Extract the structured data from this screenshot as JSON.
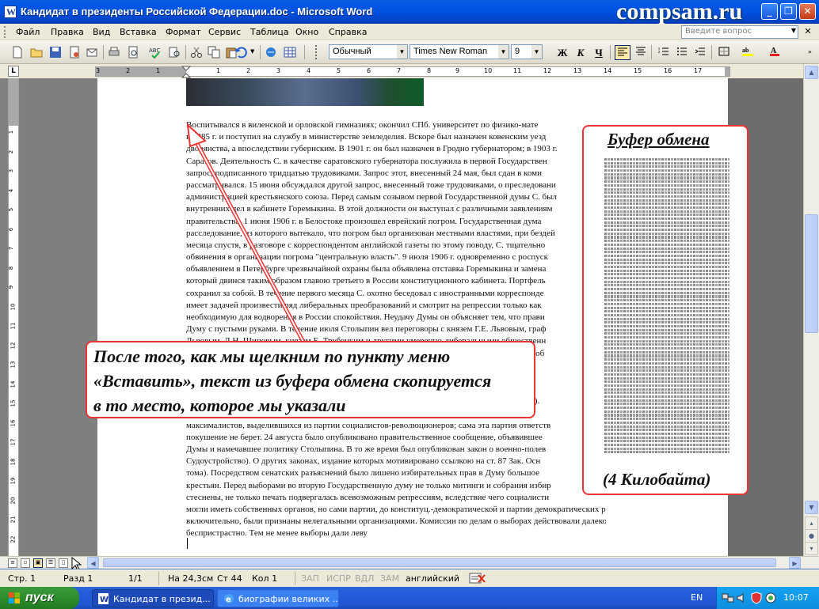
{
  "window": {
    "title": "Кандидат в президенты Российской Федерации.doc - Microsoft Word",
    "watermark": "compsam.ru"
  },
  "menubar": {
    "items": [
      "Файл",
      "Правка",
      "Вид",
      "Вставка",
      "Формат",
      "Сервис",
      "Таблица",
      "Окно",
      "Справка"
    ],
    "ask_placeholder": "Введите вопрос"
  },
  "toolbar": {
    "style": "Обычный",
    "font": "Times New Roman",
    "size": "9",
    "bold": "Ж",
    "italic": "К",
    "underline": "Ч"
  },
  "ruler": {
    "labels": [
      "3",
      "2",
      "1",
      "1",
      "2",
      "3",
      "4",
      "5",
      "6",
      "7",
      "8",
      "9",
      "10",
      "11",
      "12",
      "13",
      "14",
      "15",
      "16",
      "17"
    ],
    "tab_selector": "L"
  },
  "vruler": {
    "labels": [
      "1",
      "2",
      "3",
      "4",
      "5",
      "6",
      "7",
      "8",
      "9",
      "10",
      "11",
      "12",
      "13",
      "14",
      "15",
      "16",
      "17",
      "18",
      "19",
      "20",
      "21",
      "22"
    ]
  },
  "document": {
    "lines": [
      "Воспитывался в виленской и орловской гимназиях; окончил СПб. университет по физико-мате",
      "в 1885 г. и поступил на службу в министерстве земледелия. Вскоре был назначен ковенским уезд",
      "дворянства, а впоследствии губернским. В 1901 г. он был назначен в Гродно губернатором; в 1903 г.",
      "Саратов. Деятельность С. в качестве саратовского губернатора послужила в первой Государствен",
      "запрос, подписанного тридцатью трудовиками. Запрос этот, внесенный 24 мая, был сдан в коми",
      "рассматривался. 15 июня обсуждался другой запрос, внесенный тоже трудовиками, о преследовани",
      "администрацией крестьянского союза. Перед самым созывом первой Государственной думы С. был",
      "внутренних дел в кабинете Горемыкина. В этой должности он выступал с различными заявлениям",
      "правительства. 1 июня 1906 г. в Белостоке произошел еврейский погром. Государственная дума",
      "расследование, из которого вытекало, что погром был организован местными властями, при бездей",
      "месяца спустя, в разговоре с корреспондентом английской газеты по этому поводу, С. тщательно",
      "обвинения в организации погрома \"центральную власть\". 9 июля 1906 г. одновременно с роспуск",
      "объявлением в Петербурге чрезвычайной охраны была объявлена отставка Горемыкина и заменa",
      "который двинся таким образом главою третьего в России конституционного кабинета. Портфель",
      "сохранил за собой. В течение первого месяца С. охотно беседовал с иностранными корреспонде",
      "имеет задачей произвести ряд либеральных преобразований и смотрит на репрессии только как",
      "необходимую для водворения в России спокойствия. Неудачу Думы он объясняет тем, что прави",
      "Думу с пустыми руками. В течение июля Столыпин вел переговоры с князем Г.Е. Львовым, граф",
      "Львовым, Д.Н. Шиповым, князем Е. Трубецким и другими умеренно-либеральными общественн",
      "стараясь привлечь их в свой кабинет; но переговоры не привели ни к чему. С. обвинил в этом об",
      "",
      "",
      "",
      "получение, посредством лакея телеграммы на его даче (на Аптекарском острове в Петербурге).",
      "",
      "максималистов, выделившихся из партии социалистов-революционеров; сама эта партия ответств",
      "покушение не берет. 24 августа было опубликовано правительственное сообщение, объявившее",
      "Думы и намечавшее политику Столыпина. В то же время был опубликован закон о военно-полев",
      "Судоустройство). О других законах, издание которых мотивировано ссылкою на ст. 87 Зак. Осн",
      "тома). Посредством сенатских разъяснений было лишено избирательных прав в Думу большое",
      "крестьян. Перед выборами во вторую Государственную думу не только митинги и собрания избир",
      "стеснены, не только печать подвергалась всевозможным репрессиям, вследствие чего социалисти",
      "могли иметь собственных органов, но сами партии, до конституц.-демократической и партии демократических реформ",
      "включительно, были признаны нелегальными организациями. Комиссии по делам о выборах действовали далеко не",
      "беспристрастно. Тем не менее выборы дали леву"
    ]
  },
  "annotations": {
    "clipboard_title": "Буфер обмена",
    "clipboard_size": "(4 Килобайта)",
    "callout_lines": [
      "После того, как мы щелкним по пункту меню",
      "«Вставить», текст из буфера обмена скопируется",
      "в то место, которое мы указали"
    ]
  },
  "statusbar": {
    "page": "Стр. 1",
    "section": "Разд 1",
    "pages": "1/1",
    "position": "На 24,3см",
    "line": "Ст 44",
    "column": "Кол 1",
    "rec": "ЗАП",
    "trk": "ИСПР",
    "ext": "ВДЛ",
    "ovr": "ЗАМ",
    "language": "английский"
  },
  "taskbar": {
    "start": "пуск",
    "tasks": [
      "Кандидат в презид...",
      "биографии великих ..."
    ],
    "lang": "EN",
    "clock": "10:07"
  },
  "colors": {
    "titlebar": "#0054e3",
    "annotation_border": "#ee3333",
    "taskbar": "#245ddb",
    "start": "#2e8e2e"
  }
}
